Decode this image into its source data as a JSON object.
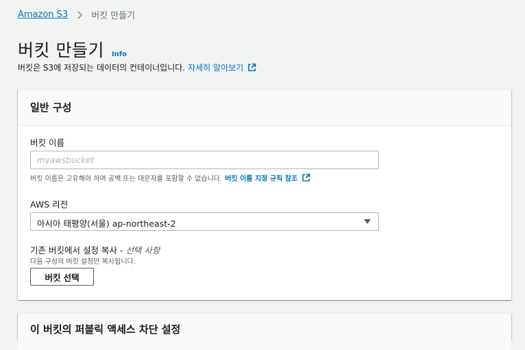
{
  "breadcrumb": {
    "root": "Amazon S3",
    "current": "버킷 만들기"
  },
  "header": {
    "title": "버킷 만들기",
    "info": "Info",
    "description": "버킷은 S3에 저장되는 데이터의 컨테이너입니다.",
    "learn_more": "자세히 알아보기"
  },
  "general": {
    "title": "일반 구성",
    "bucket_name_label": "버킷 이름",
    "bucket_name_placeholder": "myawsbucket",
    "bucket_name_value": "",
    "bucket_name_hint": "버킷 이름은 고유해야 하며 공백 또는 대문자를 포함할 수 없습니다.",
    "naming_rules_link": "버킷 이름 지정 규칙 참조",
    "region_label": "AWS 리전",
    "region_value": "아시아 태평양(서울) ap-northeast-2",
    "copy_label": "기존 버킷에서 설정 복사 - ",
    "copy_optional": "선택 사항",
    "copy_hint": "다음 구성의 버킷 설정만 복사됩니다.",
    "choose_bucket_button": "버킷 선택"
  },
  "next_panel": {
    "title": "이 버킷의 퍼블릭 액세스 차단 설정"
  },
  "icons": {
    "breadcrumb_separator": "chevron-right-icon",
    "external_link": "external-link-icon",
    "dropdown": "caret-down-icon"
  },
  "colors": {
    "link": "#0073bb",
    "background": "#f2f3f3",
    "border": "#aab7b8"
  }
}
